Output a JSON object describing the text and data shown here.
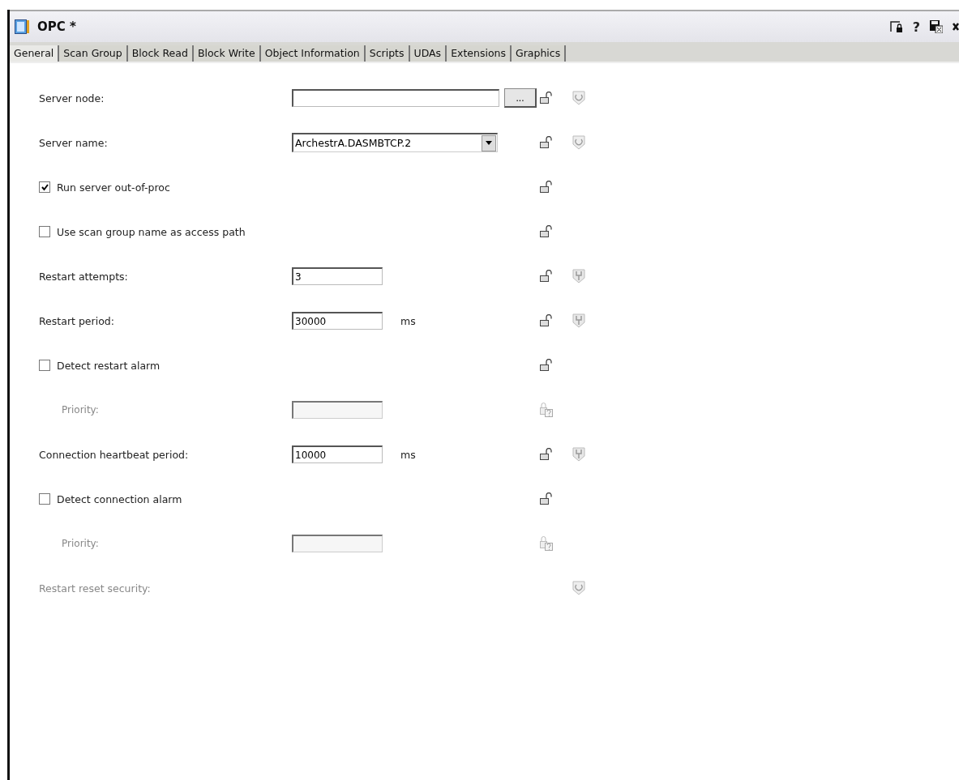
{
  "window": {
    "title": "OPC *",
    "help": "?"
  },
  "tabs": [
    {
      "label": "General",
      "selected": true
    },
    {
      "label": "Scan Group",
      "selected": false
    },
    {
      "label": "Block Read",
      "selected": false
    },
    {
      "label": "Block Write",
      "selected": false
    },
    {
      "label": "Object Information",
      "selected": false
    },
    {
      "label": "Scripts",
      "selected": false
    },
    {
      "label": "UDAs",
      "selected": false
    },
    {
      "label": "Extensions",
      "selected": false
    },
    {
      "label": "Graphics",
      "selected": false
    }
  ],
  "rows": [
    {
      "kind": "text",
      "label": "Server node:",
      "value": "",
      "browse": "...",
      "wide": true,
      "lock": {
        "kind": "open"
      },
      "shield": {
        "kind": "refresh"
      },
      "disabled": false,
      "indented": false
    },
    {
      "kind": "dropdown",
      "label": "Server name:",
      "value": "ArchestrA.DASMBTCP.2",
      "lock": {
        "kind": "open"
      },
      "shield": {
        "kind": "refresh"
      },
      "disabled": false,
      "indented": false
    },
    {
      "kind": "checkbox",
      "label": "Run server out-of-proc",
      "checked": true,
      "lock": {
        "kind": "open"
      },
      "disabled": false,
      "indented": false
    },
    {
      "kind": "checkbox",
      "label": "Use scan group name as access path",
      "checked": false,
      "lock": {
        "kind": "open"
      },
      "disabled": false,
      "indented": false
    },
    {
      "kind": "text",
      "label": "Restart attempts:",
      "value": "3",
      "wide": false,
      "lock": {
        "kind": "open"
      },
      "shield": {
        "kind": "fork"
      },
      "disabled": false,
      "indented": false
    },
    {
      "kind": "text",
      "label": "Restart period:",
      "value": "30000",
      "unit": "ms",
      "wide": false,
      "lock": {
        "kind": "open"
      },
      "shield": {
        "kind": "fork"
      },
      "disabled": false,
      "indented": false
    },
    {
      "kind": "checkbox",
      "label": "Detect restart alarm",
      "checked": false,
      "lock": {
        "kind": "open"
      },
      "disabled": false,
      "indented": false
    },
    {
      "kind": "text",
      "label": "Priority:",
      "value": "",
      "wide": false,
      "lock": {
        "kind": "unknown"
      },
      "disabled": true,
      "indented": true
    },
    {
      "kind": "text",
      "label": "Connection heartbeat period:",
      "value": "10000",
      "unit": "ms",
      "wide": false,
      "lock": {
        "kind": "open"
      },
      "shield": {
        "kind": "fork"
      },
      "disabled": false,
      "indented": false
    },
    {
      "kind": "checkbox",
      "label": "Detect connection alarm",
      "checked": false,
      "lock": {
        "kind": "open"
      },
      "disabled": false,
      "indented": false
    },
    {
      "kind": "text",
      "label": "Priority:",
      "value": "",
      "wide": false,
      "lock": {
        "kind": "unknown"
      },
      "disabled": true,
      "indented": true
    },
    {
      "kind": "label",
      "label": "Restart reset security:",
      "shield": {
        "kind": "refresh"
      },
      "disabled": true,
      "indented": false
    }
  ]
}
